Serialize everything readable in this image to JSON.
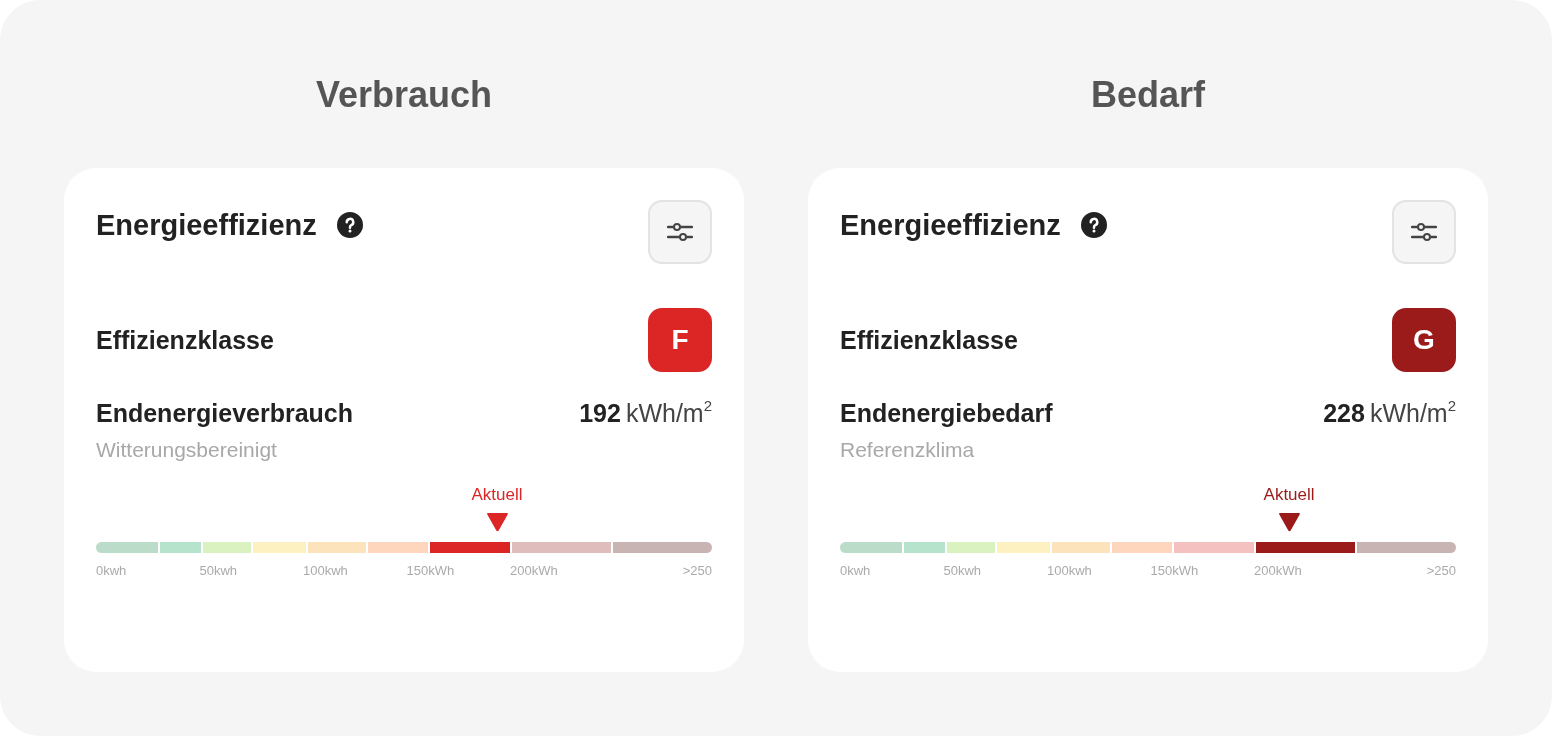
{
  "sections": [
    {
      "heading": "Verbrauch",
      "card": {
        "title": "Energieeffizienz",
        "class_label": "Effizienzklasse",
        "class": {
          "letter": "F",
          "color": "#dc2626"
        },
        "metric": {
          "label": "Endenergieverbrauch",
          "sublabel": "Witterungsbereinigt",
          "value": "192",
          "unit": "kWh/m$^{2}$"
        },
        "scale": {
          "marker": {
            "label": "Aktuell",
            "level": 0.651
          },
          "segments": [
            {
              "color": "#bcdcca"
            },
            {
              "color": "#b6e3cc"
            },
            {
              "color": "#daf2c0"
            },
            {
              "color": "#fdf1c1"
            },
            {
              "color": "#fde3bb"
            },
            {
              "color": "#fed5bd"
            },
            {
              "color": "#dc2626"
            },
            {
              "color": "#e0bdbd"
            },
            {
              "color": "#c8b4b2"
            }
          ],
          "ticks": [
            "0kwh",
            "50kwh",
            "100kwh",
            "150kWh",
            "200kWh",
            ">250"
          ]
        }
      }
    },
    {
      "heading": "Bedarf",
      "card": {
        "title": "Energieeffizienz",
        "class_label": "Effizienzklasse",
        "class": {
          "letter": "G",
          "color": "#9b1b1b"
        },
        "metric": {
          "label": "Endenergiebedarf",
          "sublabel": "Referenzklima",
          "value": "228",
          "unit": "kWh/m$^{2}$"
        },
        "scale": {
          "marker": {
            "label": "Aktuell",
            "level": 0.729
          },
          "segments": [
            {
              "color": "#bcdcca"
            },
            {
              "color": "#b6e3cc"
            },
            {
              "color": "#daf2c0"
            },
            {
              "color": "#fdf1c1"
            },
            {
              "color": "#fde3bb"
            },
            {
              "color": "#fed5bd"
            },
            {
              "color": "#f5c0c0"
            },
            {
              "color": "#9b1b1b"
            },
            {
              "color": "#c8b4b2"
            }
          ],
          "ticks": [
            "0kwh",
            "50kwh",
            "100kwh",
            "150kWh",
            "200kWh",
            ">250"
          ]
        }
      }
    }
  ]
}
